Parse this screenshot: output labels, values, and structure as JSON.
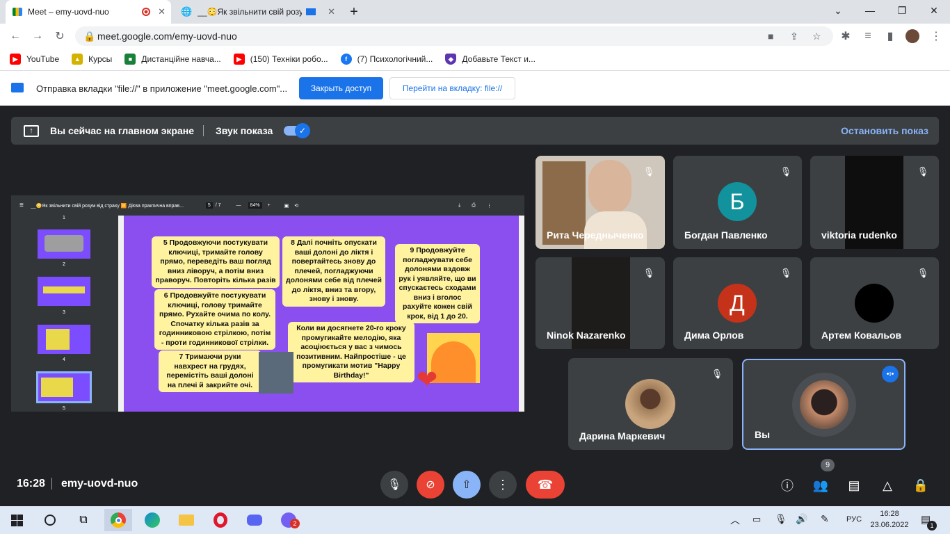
{
  "tabs": [
    {
      "title": "Meet – emy-uovd-nuo",
      "recording": true,
      "active": true
    },
    {
      "title": "__😳Як звільнити свій розу",
      "active": false
    }
  ],
  "address": "meet.google.com/emy-uovd-nuo",
  "bookmarks": [
    {
      "label": "YouTube",
      "icon": "youtube-icon",
      "color": "#ff0000"
    },
    {
      "label": "Курсы",
      "icon": "photo-icon",
      "color": "#d4b200"
    },
    {
      "label": "Дистанційне навча...",
      "icon": "classroom-icon",
      "color": "#188038"
    },
    {
      "label": "(150) Техніки робо...",
      "icon": "youtube-icon",
      "color": "#ff0000"
    },
    {
      "label": "(7) Психологічний...",
      "icon": "facebook-icon",
      "color": "#1877f2"
    },
    {
      "label": "Добавьте Текст и...",
      "icon": "shield-icon",
      "color": "#5e35b1"
    }
  ],
  "infobar": {
    "message": "Отправка вкладки \"file://\" в приложение \"meet.google.com\"...",
    "primary": "Закрыть доступ",
    "secondary": "Перейти на вкладку: file://"
  },
  "share": {
    "status": "Вы сейчас на главном экране",
    "sound_label": "Звук показа",
    "stop": "Остановить показ"
  },
  "viewer": {
    "title": "__😳Як звільнити свій розум від страху ⏸️ Дієва практична вправ...",
    "page": "5",
    "pages": "/ 7",
    "zoom": "84%",
    "thumb_numbers": [
      "1",
      "2",
      "3",
      "4",
      "5"
    ]
  },
  "slide": {
    "b5": "5  Продовжуючи постукувати ключиці, тримайте голову прямо, переведіть ваш погляд вниз ліворуч, а потім вниз праворуч. Повторіть кілька разів",
    "b6": "6  Продовжуйте постукувати ключиці, голову тримайте прямо. Рухайте очима по колу. Спочатку кілька разів за годинниковою стрілкою, потім - проти годинникової стрілки.",
    "b7": "7  Тримаючи руки навхрест на грудях, перемістіть ваші долоні на плечі й закрийте очі.",
    "b8": "8  Далі почніть опускати ваші долоні до ліктя і повертайтесь знову до плечей, погладжуючи долонями себе від плечей до ліктя, вниз та вгору, знову і знову.",
    "b9": "9  Продовжуйте погладжувати себе долонями вздовж рук і уявляйте, що ви спускаєтесь сходами вниз і вголос рахуйте кожен свій крок, від 1 до 20.",
    "b10": "Коли ви досягнете 20-го кроку промугикайте мелодію, яка асоціюється у вас з чимось позитивним. Найпростіше - це промугикати мотив \"Happy Birthday!\""
  },
  "participants": [
    {
      "name": "Рита Чередныченко",
      "type": "video",
      "muted": true
    },
    {
      "name": "Богдан Павленко",
      "initial": "Б",
      "color": "#12929d",
      "muted": true
    },
    {
      "name": "viktoria rudenko",
      "type": "video-dark",
      "muted": true
    },
    {
      "name": "Ninok Nazarenko",
      "type": "video-dark",
      "muted": true
    },
    {
      "name": "Дима Орлов",
      "initial": "Д",
      "color": "#c5321a",
      "muted": true
    },
    {
      "name": "Артем Ковальов",
      "initial": "",
      "color": "#000000",
      "muted": true
    },
    {
      "name": "Дарина Маркевич",
      "type": "photo",
      "muted": true
    },
    {
      "name": "Вы",
      "type": "photo",
      "speaking": true
    }
  ],
  "meeting": {
    "time": "16:28",
    "code": "emy-uovd-nuo",
    "people_count": "9"
  },
  "taskbar": {
    "lang": "РУС",
    "time": "16:28",
    "date": "23.06.2022",
    "notifications": "1",
    "viber_badge": "2"
  }
}
